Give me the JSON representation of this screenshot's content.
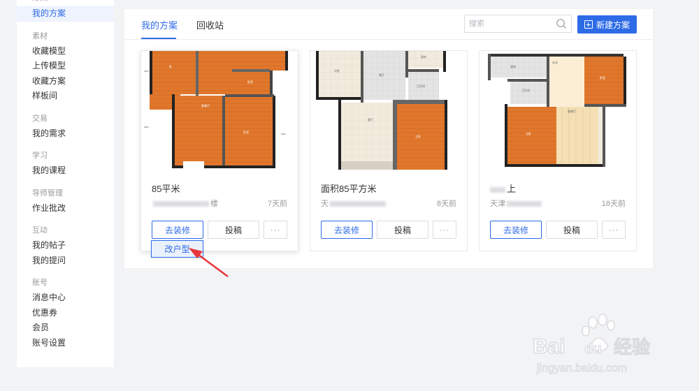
{
  "sidebar": {
    "groups": [
      {
        "title": "方案",
        "items": [
          "我的方案"
        ]
      },
      {
        "title": "素材",
        "items": [
          "收藏模型",
          "上传模型",
          "收藏方案",
          "样板间"
        ]
      },
      {
        "title": "交易",
        "items": [
          "我的需求"
        ]
      },
      {
        "title": "学习",
        "items": [
          "我的课程"
        ]
      },
      {
        "title": "导师管理",
        "items": [
          "作业批改"
        ]
      },
      {
        "title": "互动",
        "items": [
          "我的帖子",
          "我的提问"
        ]
      },
      {
        "title": "账号",
        "items": [
          "消息中心",
          "优惠券",
          "会员",
          "账号设置"
        ]
      }
    ],
    "active_item": "我的方案"
  },
  "tabs": {
    "mine": "我的方案",
    "trash": "回收站"
  },
  "search": {
    "placeholder": "搜索",
    "icon": "search-icon"
  },
  "new_button": {
    "label": "新建方案",
    "icon": "plus-square-icon"
  },
  "cards": [
    {
      "title": "85平米",
      "meta_suffix": "楼",
      "time": "7天前",
      "btn_primary": "去装修",
      "btn_secondary": "投稿",
      "btn_more": "···"
    },
    {
      "title": "面积85平方米",
      "meta_prefix": "天",
      "time": "8天前",
      "btn_primary": "去装修",
      "btn_secondary": "投稿",
      "btn_more": "···"
    },
    {
      "title": "上",
      "meta_prefix": "天津",
      "time": "18天前",
      "btn_primary": "去装修",
      "btn_secondary": "投稿",
      "btn_more": "···"
    }
  ],
  "dropdown": {
    "label": "改户型"
  },
  "colors": {
    "accent": "#2e6be6",
    "arrow": "#e8353a",
    "floor": "#e0772c"
  }
}
